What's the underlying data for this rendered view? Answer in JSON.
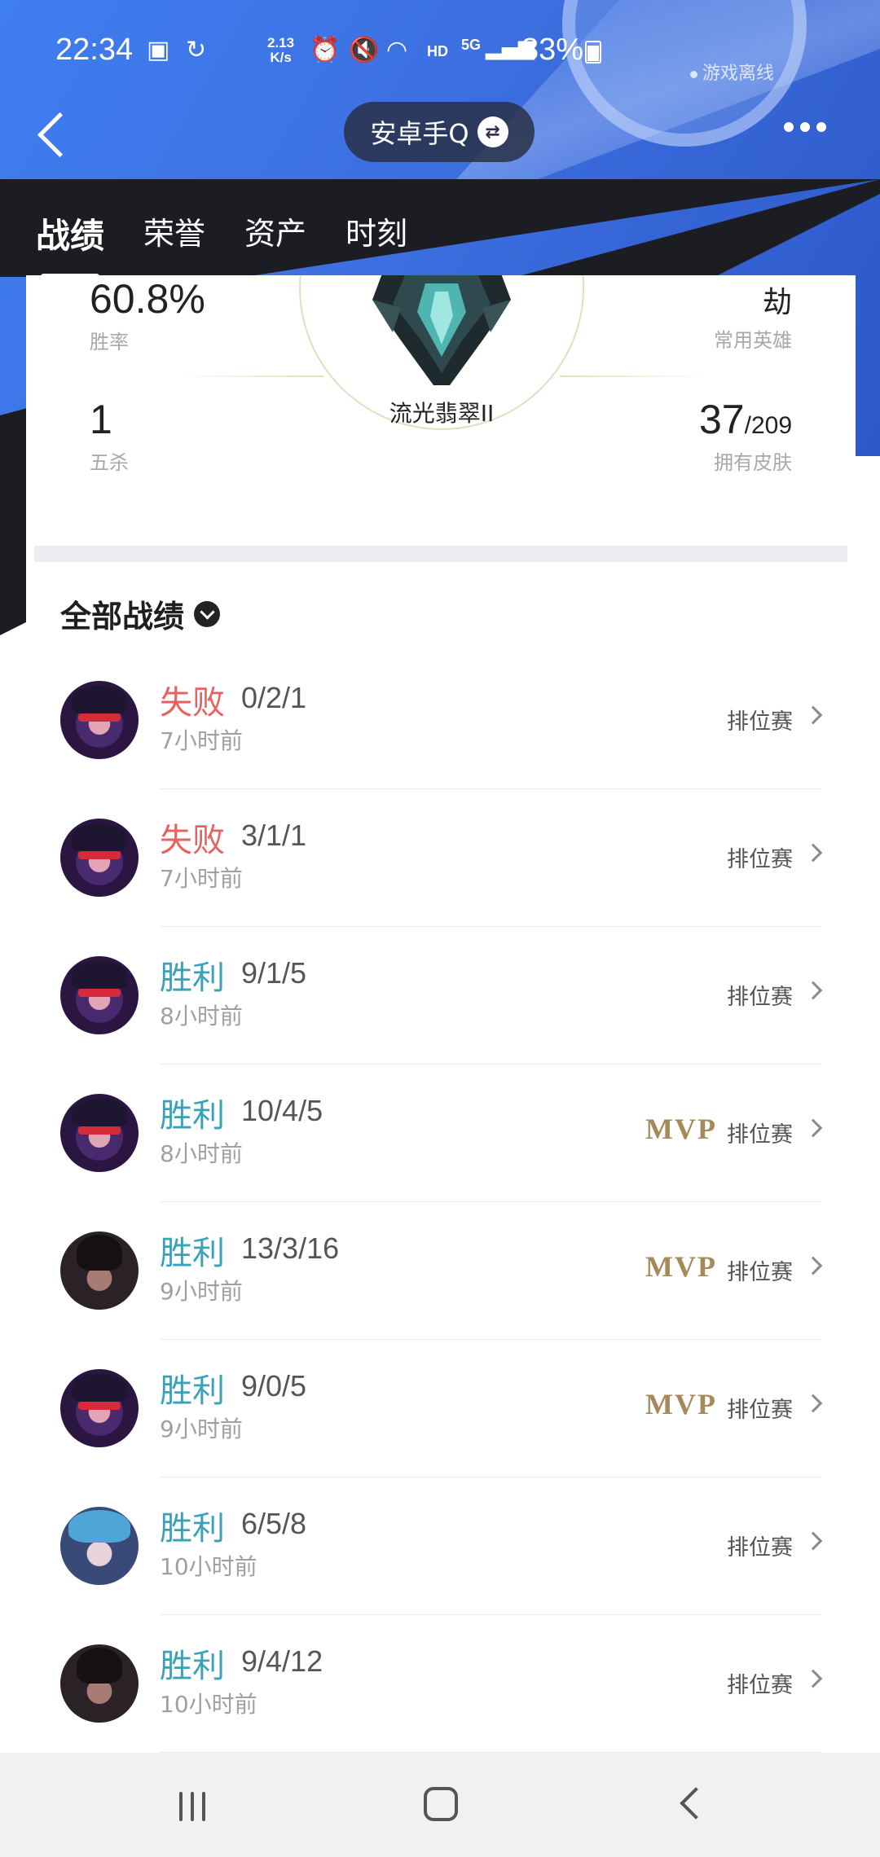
{
  "status_bar": {
    "time": "22:34",
    "net_speed_top": "2.13",
    "net_speed_unit": "K/s",
    "hd": "HD",
    "net_type": "5G",
    "battery": "83%"
  },
  "header": {
    "offline_label": "游戏离线",
    "account_name": "安卓手Q",
    "swap_icon": "swap-icon",
    "more_icon": "more-icon"
  },
  "tabs": [
    {
      "label": "战绩",
      "active": true
    },
    {
      "label": "荣誉"
    },
    {
      "label": "资产"
    },
    {
      "label": "时刻"
    }
  ],
  "stats": {
    "win_rate": {
      "value": "60.8%",
      "label": "胜率"
    },
    "pentakills": {
      "value": "1",
      "label": "五杀"
    },
    "rank": {
      "name": "流光翡翠II"
    },
    "common_hero": {
      "value": "劫",
      "label": "常用英雄"
    },
    "skins": {
      "owned": "37",
      "total": "/209",
      "label": "拥有皮肤"
    }
  },
  "section": {
    "title": "全部战绩"
  },
  "matches": [
    {
      "result": "失败",
      "type": "lose",
      "kda": "0/2/1",
      "ago": "7小时前",
      "mvp": "",
      "mode": "排位赛",
      "avatar": "vayne"
    },
    {
      "result": "失败",
      "type": "lose",
      "kda": "3/1/1",
      "ago": "7小时前",
      "mvp": "",
      "mode": "排位赛",
      "avatar": "vayne"
    },
    {
      "result": "胜利",
      "type": "win",
      "kda": "9/1/5",
      "ago": "8小时前",
      "mvp": "",
      "mode": "排位赛",
      "avatar": "vayne"
    },
    {
      "result": "胜利",
      "type": "win",
      "kda": "10/4/5",
      "ago": "8小时前",
      "mvp": "MVP",
      "mode": "排位赛",
      "avatar": "vayne"
    },
    {
      "result": "胜利",
      "type": "win",
      "kda": "13/3/16",
      "ago": "9小时前",
      "mvp": "MVP",
      "mode": "排位赛",
      "avatar": "kaisa"
    },
    {
      "result": "胜利",
      "type": "win",
      "kda": "9/0/5",
      "ago": "9小时前",
      "mvp": "MVP",
      "mode": "排位赛",
      "avatar": "vayne"
    },
    {
      "result": "胜利",
      "type": "win",
      "kda": "6/5/8",
      "ago": "10小时前",
      "mvp": "",
      "mode": "排位赛",
      "avatar": "jinx"
    },
    {
      "result": "胜利",
      "type": "win",
      "kda": "9/4/12",
      "ago": "10小时前",
      "mvp": "",
      "mode": "排位赛",
      "avatar": "kaisa"
    }
  ],
  "colors": {
    "lose": "#e7625f",
    "win": "#3aa2b8",
    "mvp": "#a6895a",
    "header_blue": "#3f7ef0",
    "header_dark": "#1c1d22"
  }
}
